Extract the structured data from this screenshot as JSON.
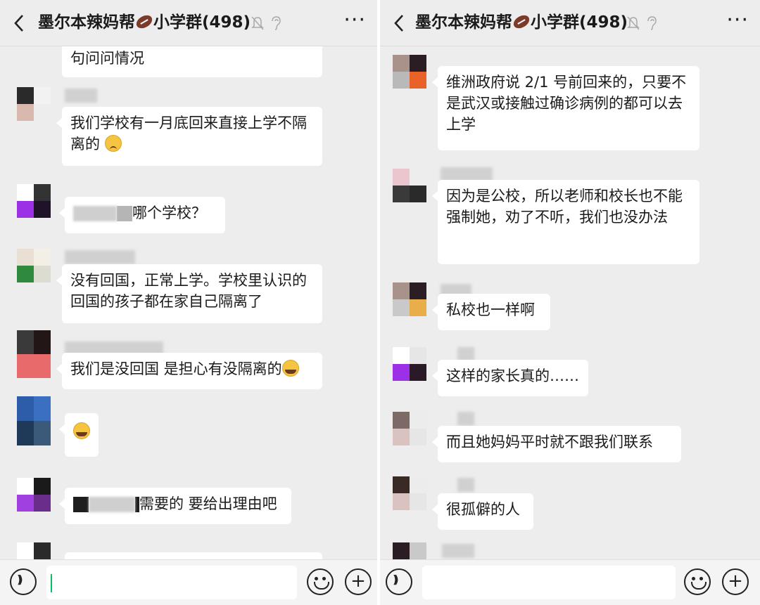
{
  "left": {
    "header": {
      "title_part1": "墨尔本辣妈帮",
      "title_part2": "小学群(498)",
      "more": "···"
    },
    "messages": [
      {
        "text": "句问问情况"
      },
      {
        "text": "我们学校有一月底回来直接上学不隔离的"
      },
      {
        "text": "哪个学校？"
      },
      {
        "text": "没有回国，正常上学。学校里认识的回国的孩子都在家自己隔离了"
      },
      {
        "text": "我们是没回国 是担心有没隔离的"
      },
      {
        "text": ""
      },
      {
        "text": "需要的 要给出理由吧"
      }
    ]
  },
  "right": {
    "header": {
      "title_part1": "墨尔本辣妈帮",
      "title_part2": "小学群(498)",
      "more": "···"
    },
    "messages": [
      {
        "text": "维洲政府说 2/1 号前回来的，只要不是武汉或接触过确诊病例的都可以去上学"
      },
      {
        "text": "因为是公校，所以老师和校长也不能强制她，劝了不听，我们也没办法"
      },
      {
        "text": "私校也一样啊"
      },
      {
        "text": "这样的家长真的……"
      },
      {
        "text": "而且她妈妈平时就不跟我们联系"
      },
      {
        "text": "很孤僻的人"
      }
    ]
  },
  "colors": {
    "background": "#ededed",
    "bubble": "#ffffff",
    "caret": "#07c160"
  },
  "icons": [
    "back-icon",
    "mute-icon",
    "ear-icon",
    "more-icon",
    "football-emoji",
    "voice-icon",
    "emoji-icon",
    "plus-icon"
  ]
}
